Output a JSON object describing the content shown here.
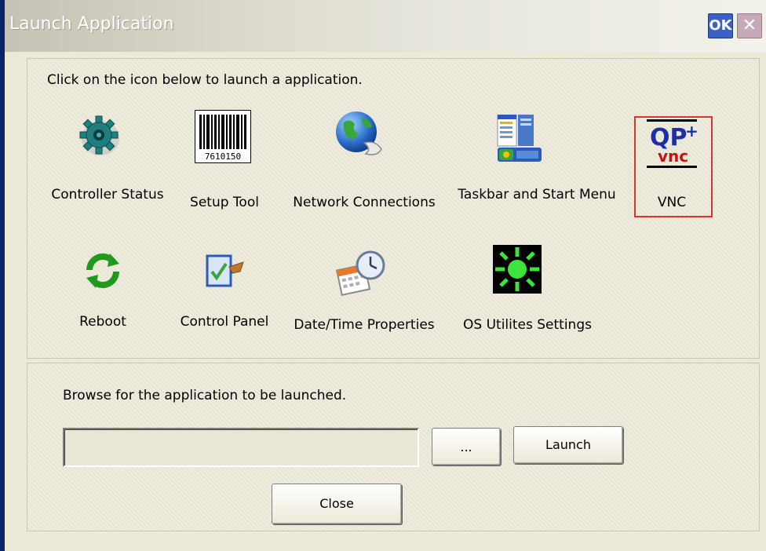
{
  "window": {
    "title": "Launch Application",
    "ok_label": "OK",
    "close_glyph": "✕"
  },
  "top_panel": {
    "instruction": "Click on the icon below to launch a application.",
    "apps": [
      {
        "label": "Controller Status",
        "icon": "gear-icon"
      },
      {
        "label": "Setup Tool",
        "icon": "barcode-icon",
        "barcode_text": "7610150"
      },
      {
        "label": "Network Connections",
        "icon": "globe-network-icon"
      },
      {
        "label": "Taskbar and Start Menu",
        "icon": "taskbar-icon"
      },
      {
        "label": "VNC",
        "icon": "qp-vnc-icon",
        "icon_text_top": "QP",
        "icon_text_plus": "+",
        "icon_text_bottom": "vnc"
      },
      {
        "label": "Reboot",
        "icon": "reboot-arrows-icon"
      },
      {
        "label": "Control Panel",
        "icon": "control-panel-icon"
      },
      {
        "label": "Date/Time Properties",
        "icon": "date-time-icon"
      },
      {
        "label": "OS Utilites Settings",
        "icon": "sun-settings-icon"
      }
    ]
  },
  "bottom_panel": {
    "instruction": "Browse for the application to be launched.",
    "path_value": "",
    "browse_label": "...",
    "launch_label": "Launch",
    "close_label": "Close"
  },
  "colors": {
    "title_bar": "#dedcd0",
    "ok_button": "#3b62c2",
    "selection_border": "#e03030",
    "window_bg": "#ece9d8"
  }
}
